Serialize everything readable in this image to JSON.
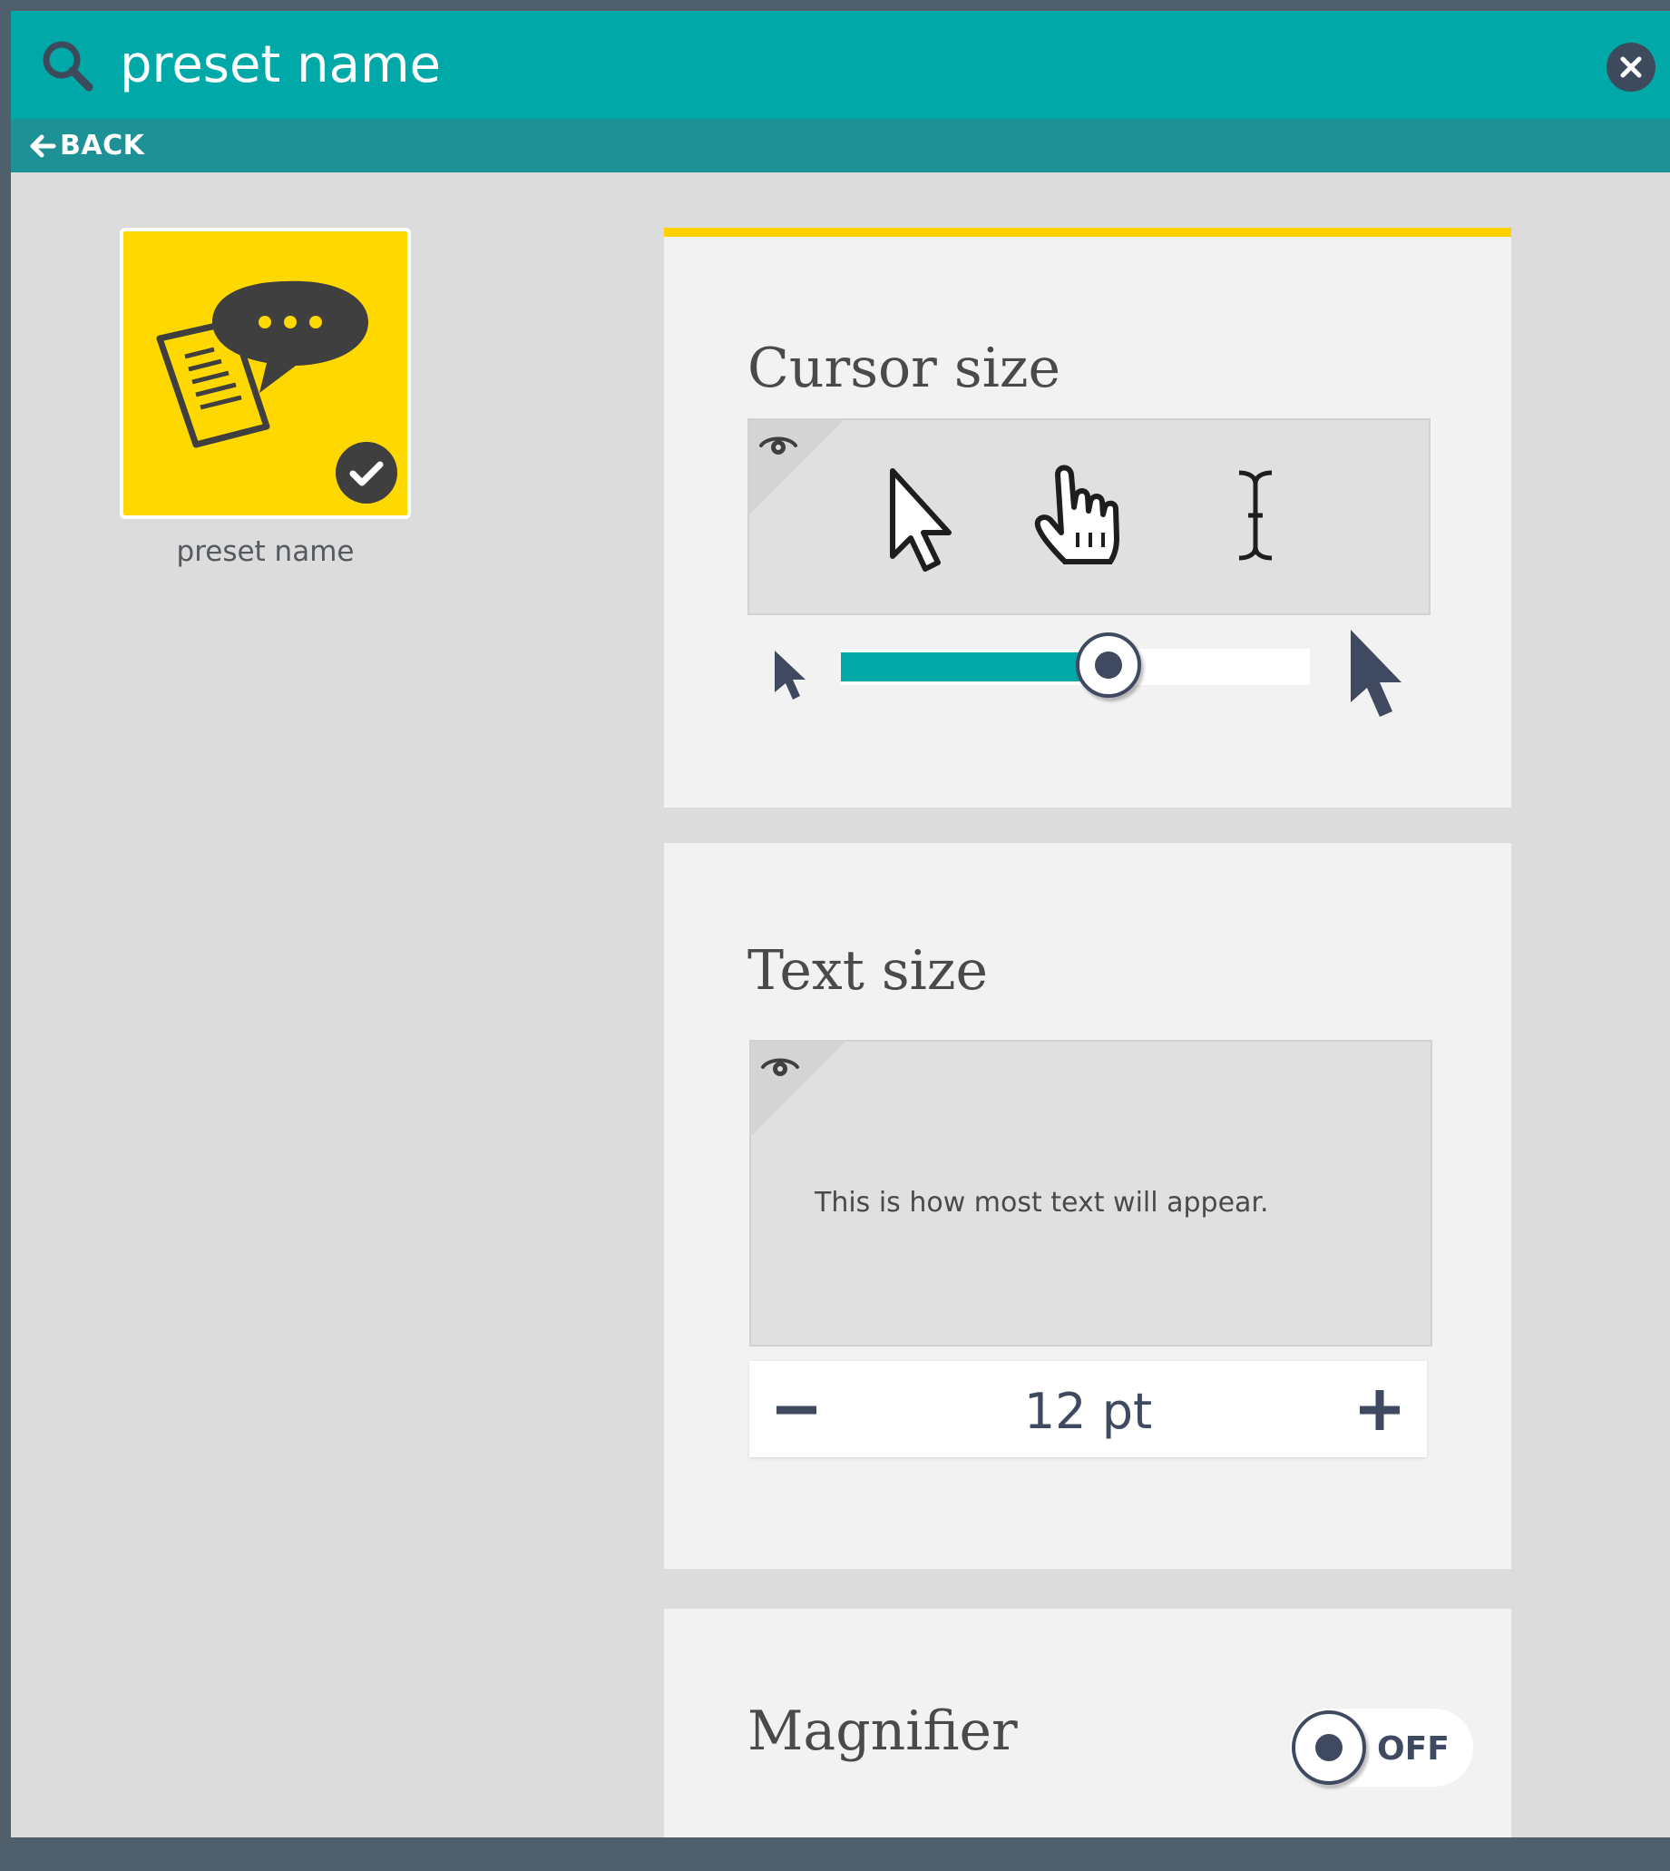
{
  "search": {
    "value": "preset name",
    "icon": "search-icon",
    "clear_icon": "close-icon"
  },
  "nav": {
    "back_label": "BACK",
    "back_icon": "arrow-left-icon"
  },
  "preset": {
    "name": "preset name",
    "selected": true,
    "icon": "speech-bubble-document-icon",
    "badge_icon": "check-icon",
    "tile_color": "#ffd800"
  },
  "panels": {
    "cursor_size": {
      "title": "Cursor size",
      "preview_icons": [
        "arrow-cursor-icon",
        "hand-cursor-icon",
        "text-cursor-icon"
      ],
      "slider_fraction": 0.57,
      "min_icon": "small-cursor-icon",
      "max_icon": "large-cursor-icon"
    },
    "text_size": {
      "title": "Text size",
      "sample_text": "This is how most text will appear.",
      "value": "12 pt",
      "decrement_icon": "minus-icon",
      "increment_icon": "plus-icon"
    },
    "magnifier": {
      "title": "Magnifier",
      "toggle_label": "OFF",
      "enabled": false
    }
  },
  "colors": {
    "accent": "#00a8a8",
    "accent_dark": "#1e9196",
    "highlight": "#fdd000",
    "control": "#3f4a60"
  }
}
